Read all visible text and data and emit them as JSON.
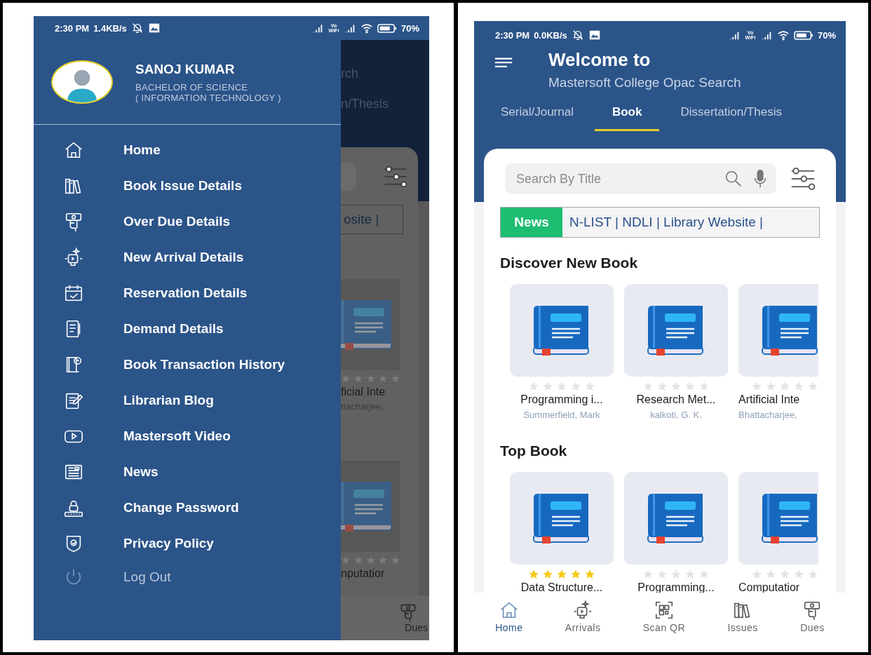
{
  "left_phone": {
    "status_bar": {
      "time": "2:30 PM",
      "speed": "1.4KB/s",
      "vowifi": "Vo WiFi",
      "battery": "70%"
    },
    "profile": {
      "name": "SANOJ KUMAR",
      "degree": "BACHELOR OF SCIENCE",
      "branch": "( INFORMATION TECHNOLOGY )"
    },
    "menu": [
      {
        "label": "Home"
      },
      {
        "label": "Book Issue Details"
      },
      {
        "label": "Over Due Details"
      },
      {
        "label": "New Arrival Details"
      },
      {
        "label": "Reservation Details"
      },
      {
        "label": "Demand Details"
      },
      {
        "label": "Book Transaction History"
      },
      {
        "label": "Librarian Blog"
      },
      {
        "label": "Mastersoft Video"
      },
      {
        "label": "News"
      },
      {
        "label": "Change Password"
      },
      {
        "label": "Privacy Policy"
      }
    ],
    "logout": {
      "label": "Log Out"
    },
    "behind_drawer": {
      "header_texts": [
        "rch",
        "n/Thesis"
      ],
      "news_text": "osite |",
      "cards": [
        {
          "title": "ficial Inte",
          "author": "ttacharjee,",
          "stars": 0
        },
        {
          "title": "nputatior",
          "stars": 0
        }
      ],
      "nav_label": "Dues"
    }
  },
  "right_phone": {
    "status_bar": {
      "time": "2:30 PM",
      "speed": "0.0KB/s",
      "vowifi": "Vo WiFi",
      "battery": "70%"
    },
    "header": {
      "title": "Welcome to",
      "subtitle": "Mastersoft College Opac Search"
    },
    "tabs": [
      {
        "label": "Serial/Journal",
        "selected": false
      },
      {
        "label": "Book",
        "selected": true
      },
      {
        "label": "Dissertation/Thesis",
        "selected": false
      }
    ],
    "search": {
      "placeholder": "Search By Title"
    },
    "news": {
      "label": "News",
      "text": "N-LIST | NDLI | Library Website |"
    },
    "sections": [
      {
        "title": "Discover New Book",
        "books": [
          {
            "title": "Programming i...",
            "author": "Summerfield, Mark",
            "stars": 0
          },
          {
            "title": "Research Met...",
            "author": "kalkoti, G. K.",
            "stars": 0
          },
          {
            "title": "Artificial Inte",
            "author": "Bhattacharjee,",
            "stars": 0
          }
        ]
      },
      {
        "title": "Top Book",
        "books": [
          {
            "title": "Data Structure...",
            "stars": 5
          },
          {
            "title": "Programming...",
            "stars": 0
          },
          {
            "title": "Computatior",
            "stars": 0
          }
        ]
      }
    ],
    "bottom_nav": [
      {
        "label": "Home",
        "selected": true
      },
      {
        "label": "Arrivals",
        "selected": false
      },
      {
        "label": "Scan QR",
        "selected": false
      },
      {
        "label": "Issues",
        "selected": false
      },
      {
        "label": "Dues",
        "selected": false
      }
    ]
  }
}
